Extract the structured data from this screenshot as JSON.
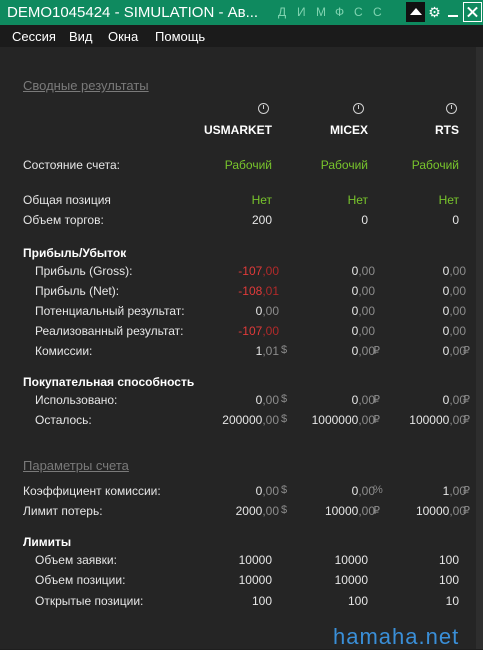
{
  "window": {
    "title": "DEMO1045424 - SIMULATION - Ав...",
    "quick_letters": [
      "Д",
      "И",
      "М",
      "Ф",
      "С",
      "С"
    ]
  },
  "menu": [
    "Сессия",
    "Вид",
    "Окна",
    "Помощь"
  ],
  "sections": {
    "summary": "Сводные результаты",
    "pnl": "Прибыль/Убыток",
    "buying_power": "Покупательная способность",
    "account_params": "Параметры счета",
    "limits": "Лимиты"
  },
  "columns": [
    "USMARKET",
    "MICEX",
    "RTS"
  ],
  "rows": {
    "account_state": {
      "label": "Состояние счета:",
      "values": [
        "Рабочий",
        "Рабочий",
        "Рабочий"
      ]
    },
    "total_position": {
      "label": "Общая позиция",
      "values": [
        "Нет",
        "Нет",
        "Нет"
      ]
    },
    "trade_volume": {
      "label": "Объем торгов:",
      "values": [
        "200",
        "0",
        "0"
      ]
    },
    "profit_gross": {
      "label": "Прибыль (Gross):",
      "int": [
        "-107",
        "0",
        "0"
      ],
      "dec": [
        ",00",
        ",00",
        ",00"
      ]
    },
    "profit_net": {
      "label": "Прибыль (Net):",
      "int": [
        "-108",
        "0",
        "0"
      ],
      "dec": [
        ",01",
        ",00",
        ",00"
      ]
    },
    "potential": {
      "label": "Потенциальный результат:",
      "int": [
        "0",
        "0",
        "0"
      ],
      "dec": [
        ",00",
        ",00",
        ",00"
      ]
    },
    "realized": {
      "label": "Реализованный результат:",
      "int": [
        "-107",
        "0",
        "0"
      ],
      "dec": [
        ",00",
        ",00",
        ",00"
      ]
    },
    "commissions": {
      "label": "Комиссии:",
      "int": [
        "1",
        "0",
        "0"
      ],
      "dec": [
        ",01",
        ",00",
        ",00"
      ],
      "units": [
        "$",
        "₽",
        "₽"
      ]
    },
    "used": {
      "label": "Использовано:",
      "int": [
        "0",
        "0",
        "0"
      ],
      "dec": [
        ",00",
        ",00",
        ",00"
      ],
      "units": [
        "$",
        "₽",
        "₽"
      ]
    },
    "remaining": {
      "label": "Осталось:",
      "int": [
        "200000",
        "1000000",
        "100000"
      ],
      "dec": [
        ",00",
        ",00",
        ",00"
      ],
      "units": [
        "$",
        "₽",
        "₽"
      ]
    },
    "commission_coef": {
      "label": "Коэффициент комиссии:",
      "int": [
        "0",
        "0",
        "1"
      ],
      "dec": [
        ",00",
        ",00",
        ",00"
      ],
      "units": [
        "$",
        "%",
        "₽"
      ]
    },
    "loss_limit": {
      "label": "Лимит потерь:",
      "int": [
        "2000",
        "10000",
        "10000"
      ],
      "dec": [
        ",00",
        ",00",
        ",00"
      ],
      "units": [
        "$",
        "₽",
        "₽"
      ]
    },
    "order_volume": {
      "label": "Объем заявки:",
      "values": [
        "10000",
        "10000",
        "100"
      ]
    },
    "position_volume": {
      "label": "Объем позиции:",
      "values": [
        "10000",
        "10000",
        "100"
      ]
    },
    "open_positions": {
      "label": "Открытые позиции:",
      "values": [
        "100",
        "100",
        "10"
      ]
    }
  },
  "watermark": "hamaha.net",
  "colors": {
    "titlebar": "#0f8a5f",
    "positive": "#78c42c",
    "negative": "#e03a3a",
    "background": "#252525"
  }
}
